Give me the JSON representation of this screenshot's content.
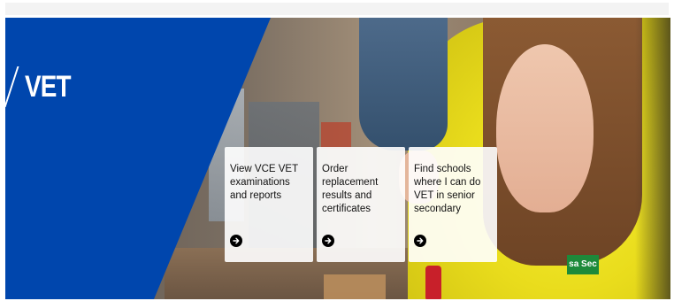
{
  "hero": {
    "title": "VET",
    "brand_color": "#0046ad",
    "photo_badge": "sa Sec"
  },
  "cards": [
    {
      "label": "View VCE VET examinations and reports",
      "icon": "arrow-right-circle-icon"
    },
    {
      "label": "Order replacement results and certificates",
      "icon": "arrow-right-circle-icon"
    },
    {
      "label": "Find schools where I can do VET in senior secondary",
      "icon": "arrow-right-circle-icon"
    }
  ]
}
